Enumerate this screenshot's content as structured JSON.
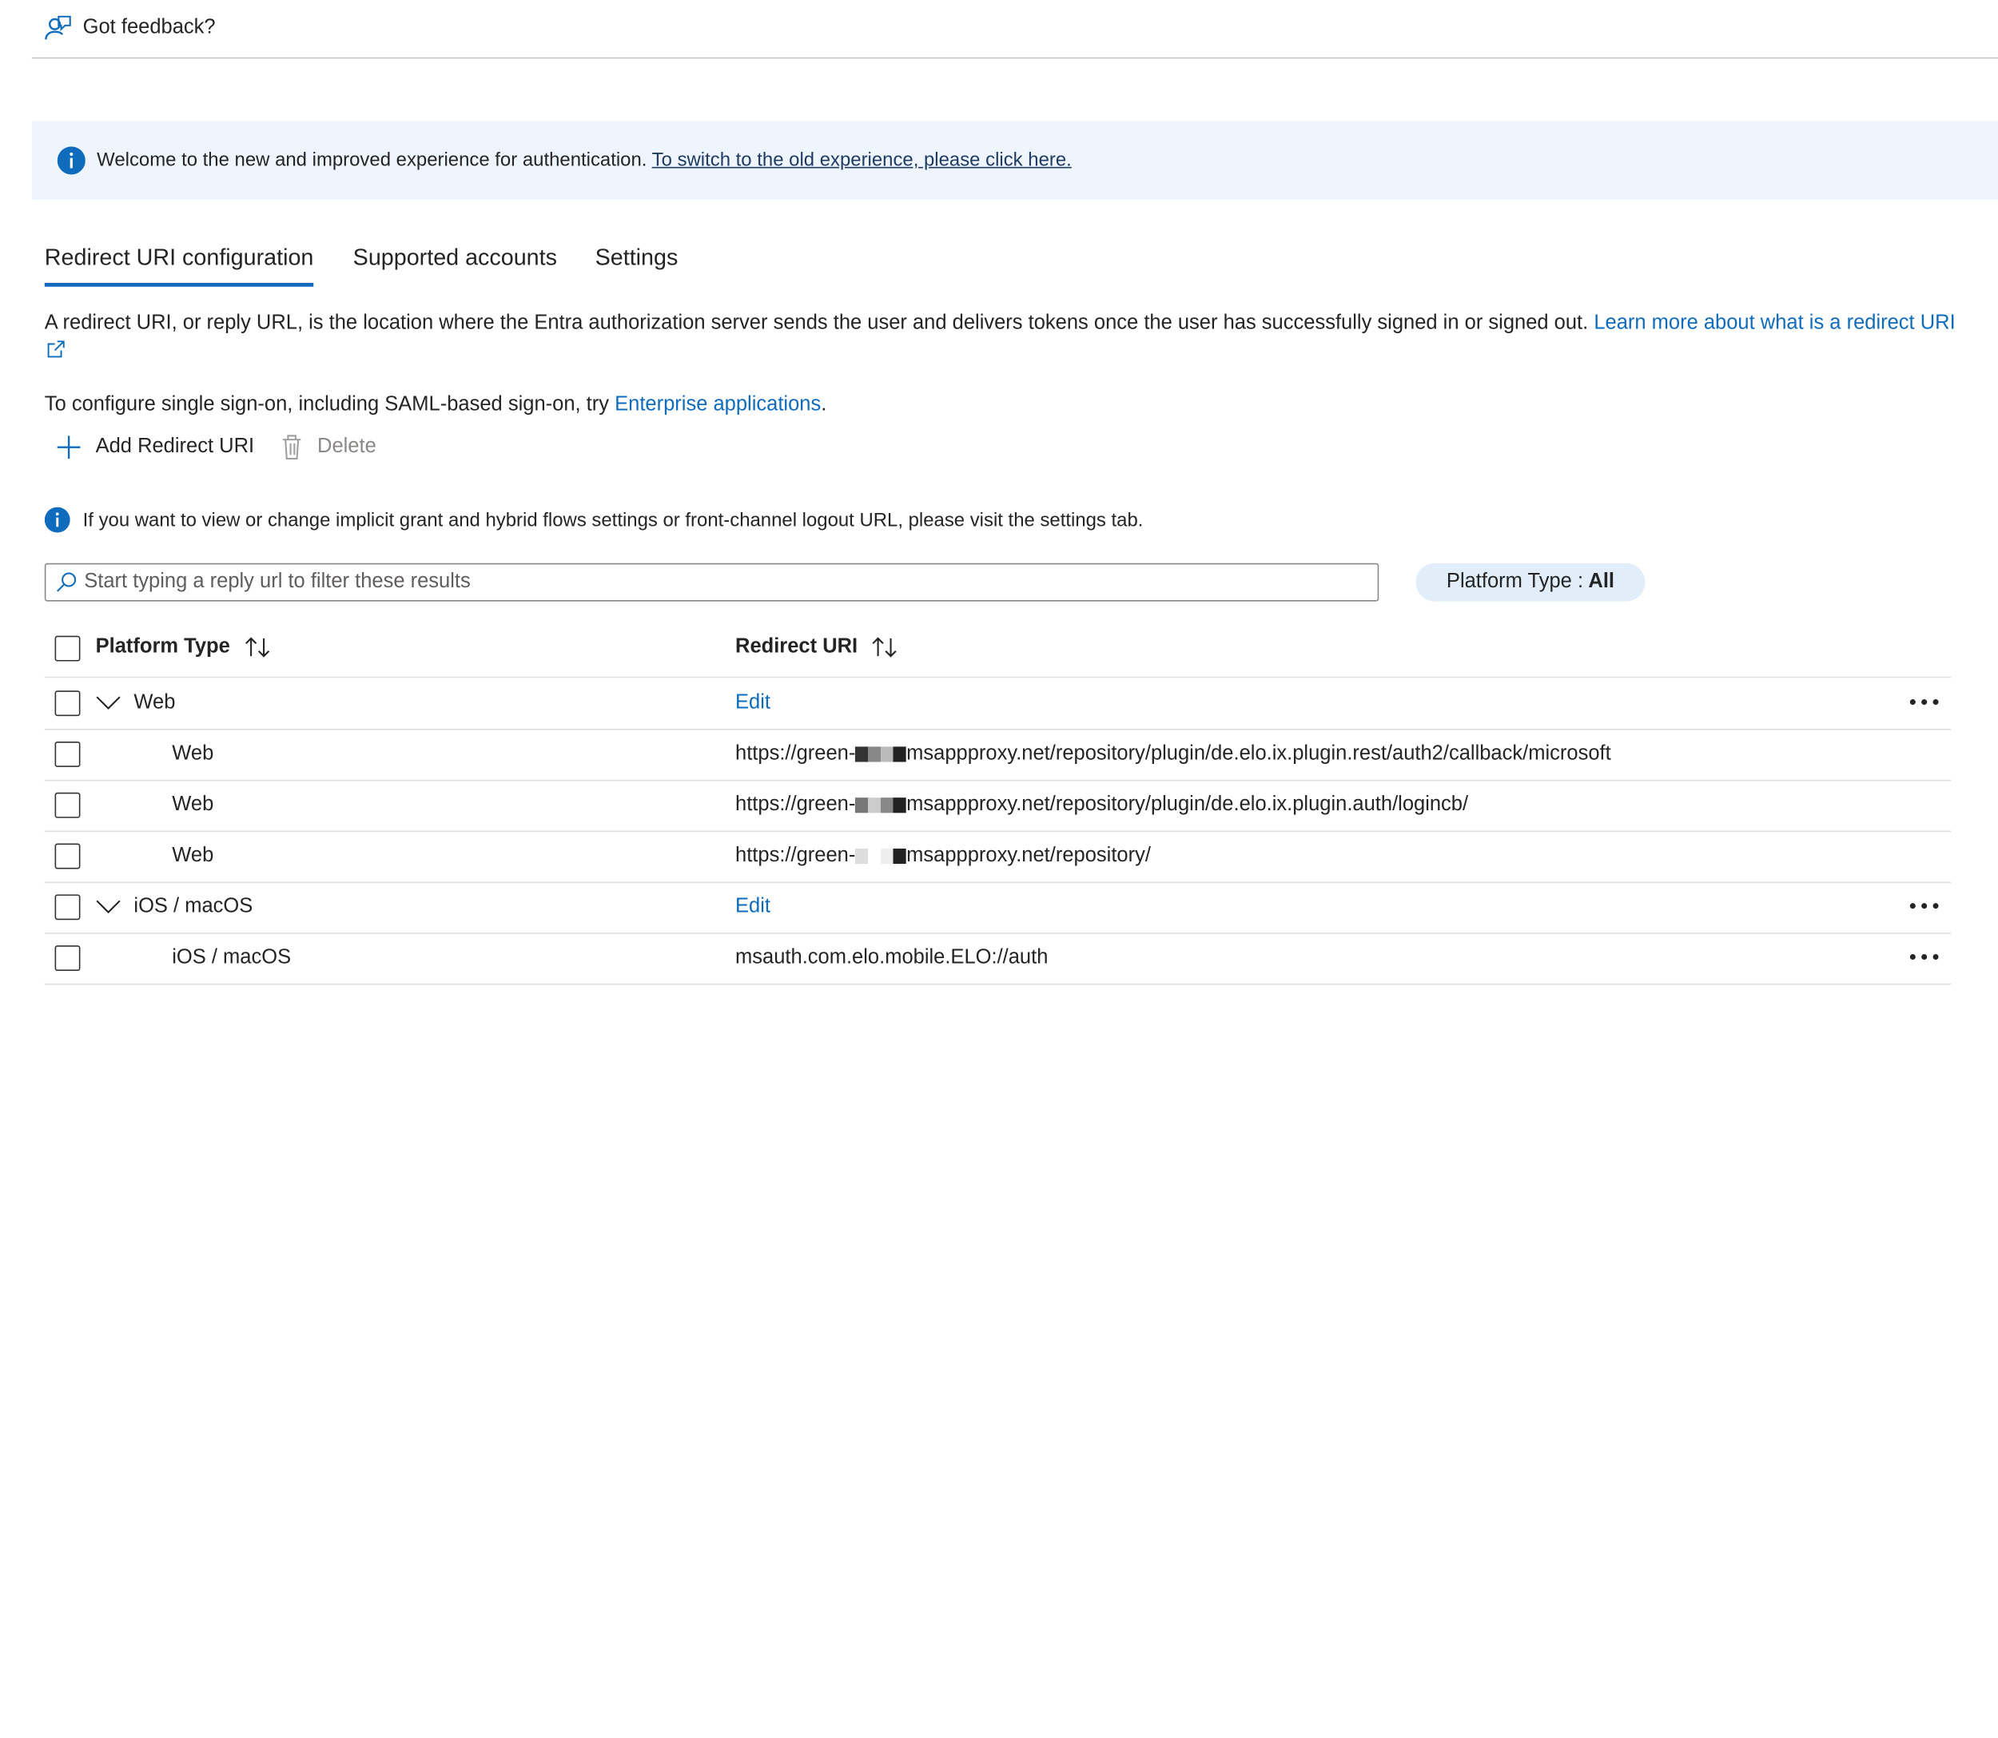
{
  "feedback": {
    "label": "Got feedback?",
    "icon": "feedback-person-icon"
  },
  "banner": {
    "text": "Welcome to the new and improved experience for authentication. ",
    "link": "To switch to the old experience, please click here.",
    "icon": "info-icon"
  },
  "tabs": [
    {
      "label": "Redirect URI configuration",
      "active": true
    },
    {
      "label": "Supported accounts",
      "active": false
    },
    {
      "label": "Settings",
      "active": false
    }
  ],
  "description": {
    "text": "A redirect URI, or reply URL, is the location where the Entra authorization server sends the user and delivers tokens once the user has successfully signed in or signed out.  ",
    "link": "Learn more about what is a redirect URI"
  },
  "sso": {
    "text": "To configure single sign-on, including SAML-based sign-on, try ",
    "link": "Enterprise applications",
    "suffix": "."
  },
  "toolbar": {
    "add_label": "Add Redirect URI",
    "delete_label": "Delete"
  },
  "note": {
    "text": "If you want to view or change implicit grant and hybrid flows settings or front-channel logout URL, please visit the settings tab."
  },
  "search": {
    "placeholder": "Start typing a reply url to filter these results",
    "value": ""
  },
  "filter": {
    "label": "Platform Type : ",
    "value": "All"
  },
  "table": {
    "headers": {
      "platform": "Platform Type",
      "uri": "Redirect URI"
    },
    "groups": [
      {
        "platform": "Web",
        "action": "Edit",
        "rows": [
          {
            "platform": "Web",
            "uri_prefix": "https://green-",
            "uri_suffix": "msappproxy.net/repository/plugin/de.elo.ix.plugin.rest/auth2/callback/microsoft"
          },
          {
            "platform": "Web",
            "uri_prefix": "https://green-",
            "uri_suffix": "msappproxy.net/repository/plugin/de.elo.ix.plugin.auth/logincb/"
          },
          {
            "platform": "Web",
            "uri_prefix": "https://green-",
            "uri_suffix": "msappproxy.net/repository/"
          }
        ]
      },
      {
        "platform": "iOS / macOS",
        "action": "Edit",
        "rows": [
          {
            "platform": "iOS / macOS",
            "uri": "msauth.com.elo.mobile.ELO://auth"
          }
        ]
      }
    ]
  },
  "colors": {
    "accent": "#0f6cbd",
    "banner_bg": "#eff5fc",
    "pill_bg": "#e1eefa"
  }
}
